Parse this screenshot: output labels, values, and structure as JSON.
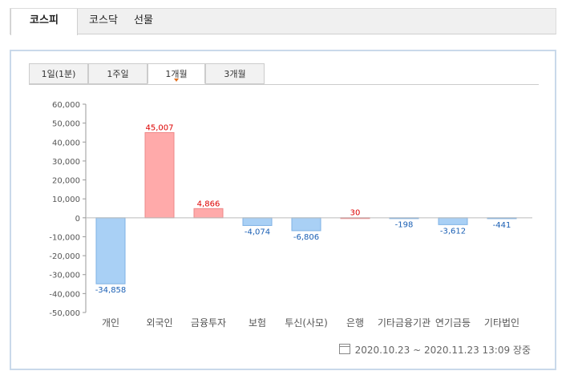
{
  "top_tabs": [
    {
      "label": "코스피",
      "active": true
    },
    {
      "label": "코스닥",
      "active": false
    },
    {
      "label": "선물",
      "active": false
    }
  ],
  "period_tabs": [
    {
      "label": "1일(1분)",
      "active": false
    },
    {
      "label": "1주일",
      "active": false
    },
    {
      "label": "1개월",
      "active": true
    },
    {
      "label": "3개월",
      "active": false
    }
  ],
  "footer": {
    "text": "2020.10.23 ~ 2020.11.23 13:09 장중"
  },
  "colors": {
    "positive_fill": "#ffaaaa",
    "positive_stroke": "#ee8888",
    "negative_fill": "#a9d0f5",
    "negative_stroke": "#7fb2e5",
    "positive_label": "#dd0000",
    "negative_label": "#1a5fb4"
  },
  "chart_data": {
    "type": "bar",
    "title": "",
    "xlabel": "",
    "ylabel": "",
    "ylim": [
      -50000,
      60000
    ],
    "yticks": [
      "60,000",
      "50,000",
      "40,000",
      "30,000",
      "20,000",
      "10,000",
      "0",
      "-10,000",
      "-20,000",
      "-30,000",
      "-40,000",
      "-50,000"
    ],
    "ytick_values": [
      60000,
      50000,
      40000,
      30000,
      20000,
      10000,
      0,
      -10000,
      -20000,
      -30000,
      -40000,
      -50000
    ],
    "categories": [
      "개인",
      "외국인",
      "금융투자",
      "보험",
      "투신(사모)",
      "은행",
      "기타금융기관",
      "연기금등",
      "기타법인"
    ],
    "values": [
      -34858,
      45007,
      4866,
      -4074,
      -6806,
      30,
      -198,
      -3612,
      -441
    ],
    "value_labels": [
      "-34,858",
      "45,007",
      "4,866",
      "-4,074",
      "-6,806",
      "30",
      "-198",
      "-3,612",
      "-441"
    ],
    "grid": false,
    "legend": "none"
  }
}
